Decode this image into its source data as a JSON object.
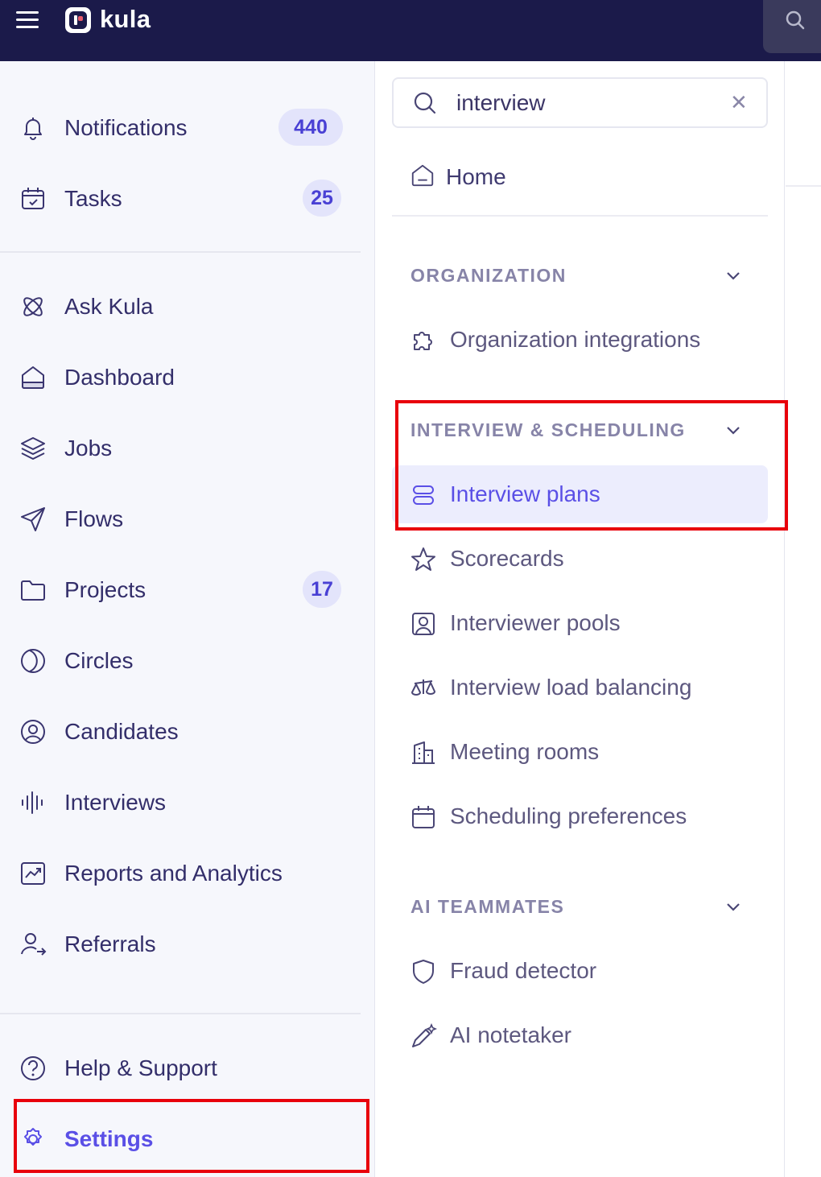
{
  "topbar": {
    "brand": "kula"
  },
  "sidebar": {
    "items": [
      {
        "label": "Notifications",
        "badge": "440",
        "icon": "bell-icon"
      },
      {
        "label": "Tasks",
        "badge": "25",
        "icon": "calendar-check-icon"
      },
      {
        "label": "Ask Kula",
        "icon": "atom-icon"
      },
      {
        "label": "Dashboard",
        "icon": "home-icon"
      },
      {
        "label": "Jobs",
        "icon": "layers-icon"
      },
      {
        "label": "Flows",
        "icon": "send-icon"
      },
      {
        "label": "Projects",
        "badge": "17",
        "icon": "folder-icon"
      },
      {
        "label": "Circles",
        "icon": "circles-icon"
      },
      {
        "label": "Candidates",
        "icon": "user-circle-icon"
      },
      {
        "label": "Interviews",
        "icon": "waveform-icon"
      },
      {
        "label": "Reports and Analytics",
        "icon": "chart-icon"
      },
      {
        "label": "Referrals",
        "icon": "user-arrow-icon"
      },
      {
        "label": "Help & Support",
        "icon": "help-circle-icon"
      },
      {
        "label": "Settings",
        "icon": "gear-icon",
        "active": true
      }
    ]
  },
  "panel": {
    "search": {
      "value": "interview",
      "placeholder": "Search"
    },
    "home_label": "Home",
    "sections": [
      {
        "title": "ORGANIZATION",
        "items": [
          {
            "label": "Organization integrations",
            "icon": "puzzle-icon"
          }
        ]
      },
      {
        "title": "INTERVIEW & SCHEDULING",
        "items": [
          {
            "label": "Interview plans",
            "icon": "stack-icon",
            "active": true
          },
          {
            "label": "Scorecards",
            "icon": "star-icon"
          },
          {
            "label": "Interviewer pools",
            "icon": "user-square-icon"
          },
          {
            "label": "Interview load balancing",
            "icon": "scale-icon"
          },
          {
            "label": "Meeting rooms",
            "icon": "building-icon"
          },
          {
            "label": "Scheduling preferences",
            "icon": "calendar-icon"
          }
        ]
      },
      {
        "title": "AI TEAMMATES",
        "items": [
          {
            "label": "Fraud detector",
            "icon": "shield-icon"
          },
          {
            "label": "AI notetaker",
            "icon": "pen-sparkle-icon"
          }
        ]
      }
    ]
  },
  "colors": {
    "topbar": "#1b1a4a",
    "accent": "#5a4fe6",
    "highlight": "#e8000b"
  }
}
